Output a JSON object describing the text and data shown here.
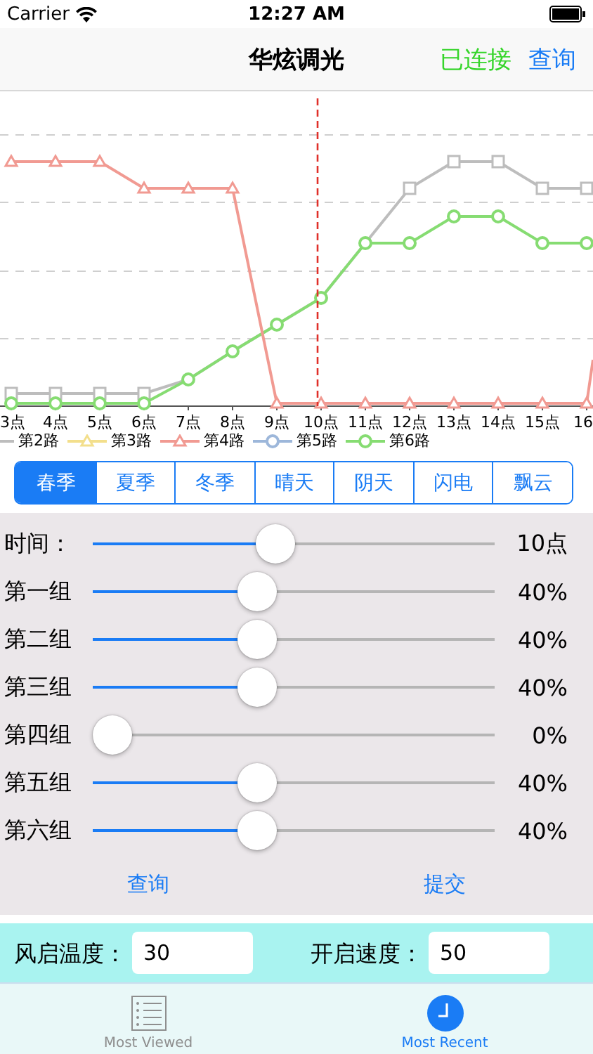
{
  "status_bar": {
    "carrier": "Carrier",
    "time": "12:27 AM"
  },
  "nav": {
    "title": "华炫调光",
    "status": "已连接",
    "action": "查询"
  },
  "chart": {
    "x_labels": [
      "3点",
      "4点",
      "5点",
      "6点",
      "7点",
      "8点",
      "9点",
      "10点",
      "11点",
      "12点",
      "13点",
      "14点",
      "15点",
      "16"
    ],
    "legend": [
      {
        "label": "第2路",
        "color": "#bdbdbd",
        "kind": "square"
      },
      {
        "label": "第3路",
        "color": "#f3df8c",
        "kind": "triangle"
      },
      {
        "label": "第4路",
        "color": "#f19a92",
        "kind": "triangle"
      },
      {
        "label": "第5路",
        "color": "#9db7da",
        "kind": "circle"
      },
      {
        "label": "第6路",
        "color": "#86dc72",
        "kind": "circle"
      }
    ]
  },
  "segments": [
    {
      "label": "春季",
      "selected": true
    },
    {
      "label": "夏季",
      "selected": false
    },
    {
      "label": "冬季",
      "selected": false
    },
    {
      "label": "晴天",
      "selected": false
    },
    {
      "label": "阴天",
      "selected": false
    },
    {
      "label": "闪电",
      "selected": false
    },
    {
      "label": "飘云",
      "selected": false
    }
  ],
  "sliders": [
    {
      "label": "时间：",
      "level": 0.45,
      "reading": "10点"
    },
    {
      "label": "第一组",
      "level": 0.4,
      "reading": "40%"
    },
    {
      "label": "第二组",
      "level": 0.4,
      "reading": "40%"
    },
    {
      "label": "第三组",
      "level": 0.4,
      "reading": "40%"
    },
    {
      "label": "第四组",
      "level": 0,
      "reading": "0%"
    },
    {
      "label": "第五组",
      "level": 0.4,
      "reading": "40%"
    },
    {
      "label": "第六组",
      "level": 0.4,
      "reading": "40%"
    }
  ],
  "buttons": [
    "查询",
    "提交"
  ],
  "settings": [
    {
      "label": "风启温度：",
      "value": "30"
    },
    {
      "label": "开启速度：",
      "value": "50"
    }
  ],
  "tabs": [
    {
      "label": "Most Viewed",
      "kind": "list",
      "selected": false
    },
    {
      "label": "Most Recent",
      "kind": "clock",
      "selected": true
    }
  ]
}
